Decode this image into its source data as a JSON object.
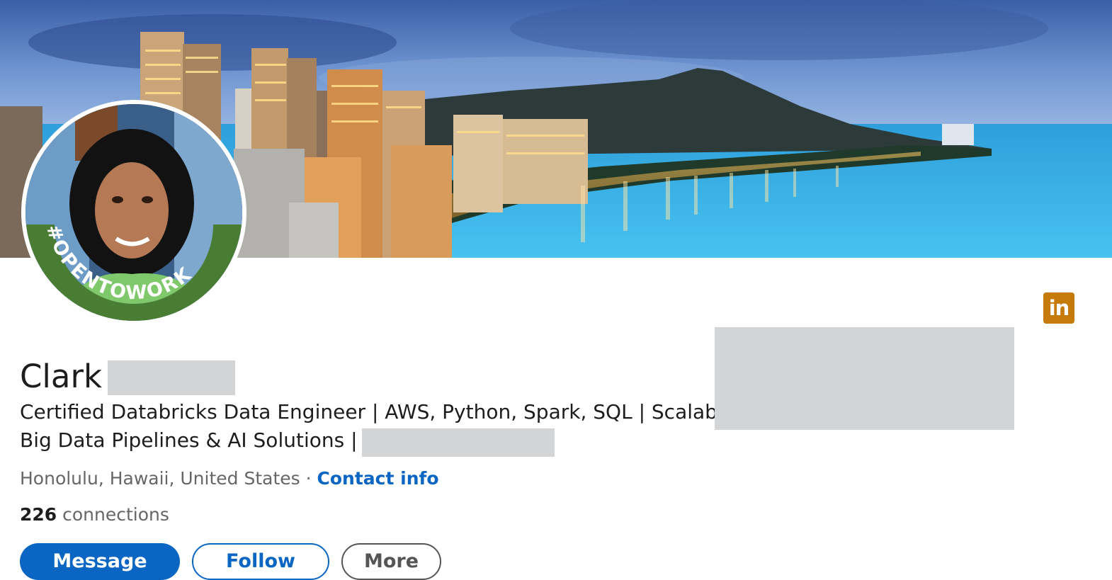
{
  "profile": {
    "first_name": "Clark",
    "headline_line1": "Certified Databricks Data Engineer | AWS, Python, Spark, SQL | Scalable",
    "headline_line2": "Big Data Pipelines & AI Solutions |",
    "location": "Honolulu, Hawaii, United States",
    "separator": "·",
    "contact_info": "Contact info",
    "connections_count": "226",
    "connections_label": "connections",
    "open_to_work_badge": "#OPENTOWORK"
  },
  "actions": {
    "message_label": "Message",
    "follow_label": "Follow",
    "more_label": "More"
  },
  "logo": {
    "text": "in",
    "color": "#c57a0a"
  },
  "colors": {
    "link": "#0a66c2",
    "primary_button": "#0a66c2",
    "open_to_work_ring": "#4a7d34",
    "redaction": "#d3d4d6"
  },
  "icons": [
    "linkedin-icon"
  ]
}
